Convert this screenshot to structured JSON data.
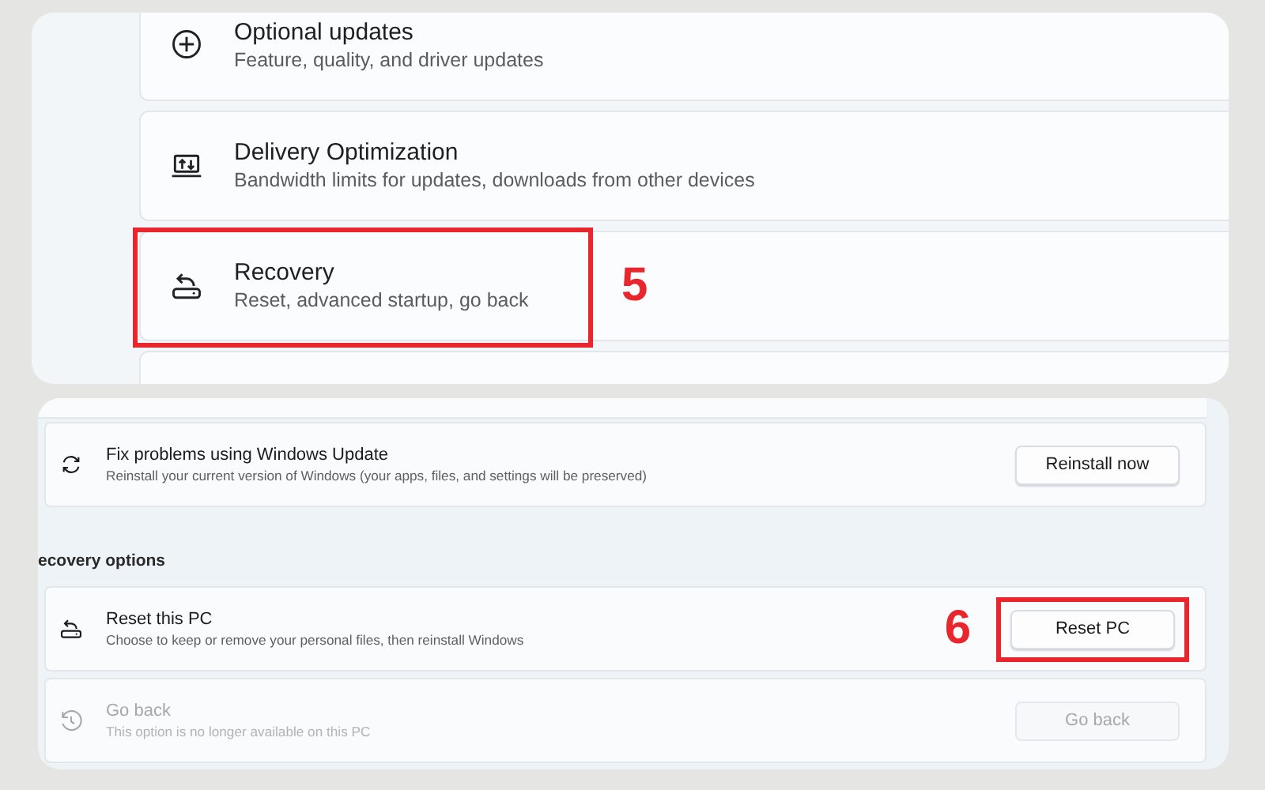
{
  "settings_list": [
    {
      "title": "Optional updates",
      "subtitle": "Feature, quality, and driver updates",
      "highlighted": false
    },
    {
      "title": "Delivery Optimization",
      "subtitle": "Bandwidth limits for updates, downloads from other devices",
      "highlighted": false
    },
    {
      "title": "Recovery",
      "subtitle": "Reset, advanced startup, go back",
      "highlighted": true,
      "step": "5"
    },
    {
      "highlighted": false
    }
  ],
  "recovery_page": {
    "top_row": {
      "title": "Fix problems using Windows Update",
      "subtitle": "Reinstall your current version of Windows (your apps, files, and settings will be preserved)",
      "button": {
        "label": "Reinstall now",
        "disabled": false,
        "highlighted": false
      },
      "disabled": false
    },
    "section_heading": "ecovery options",
    "rows": [
      {
        "title": "Reset this PC",
        "subtitle": "Choose to keep or remove your personal files, then reinstall Windows",
        "button": {
          "label": "Reset PC",
          "disabled": false,
          "highlighted": true,
          "step": "6"
        },
        "disabled": false
      },
      {
        "title": "Go back",
        "subtitle": "This option is no longer available on this PC",
        "button": {
          "label": "Go back",
          "disabled": true,
          "highlighted": false
        },
        "disabled": true
      }
    ]
  }
}
